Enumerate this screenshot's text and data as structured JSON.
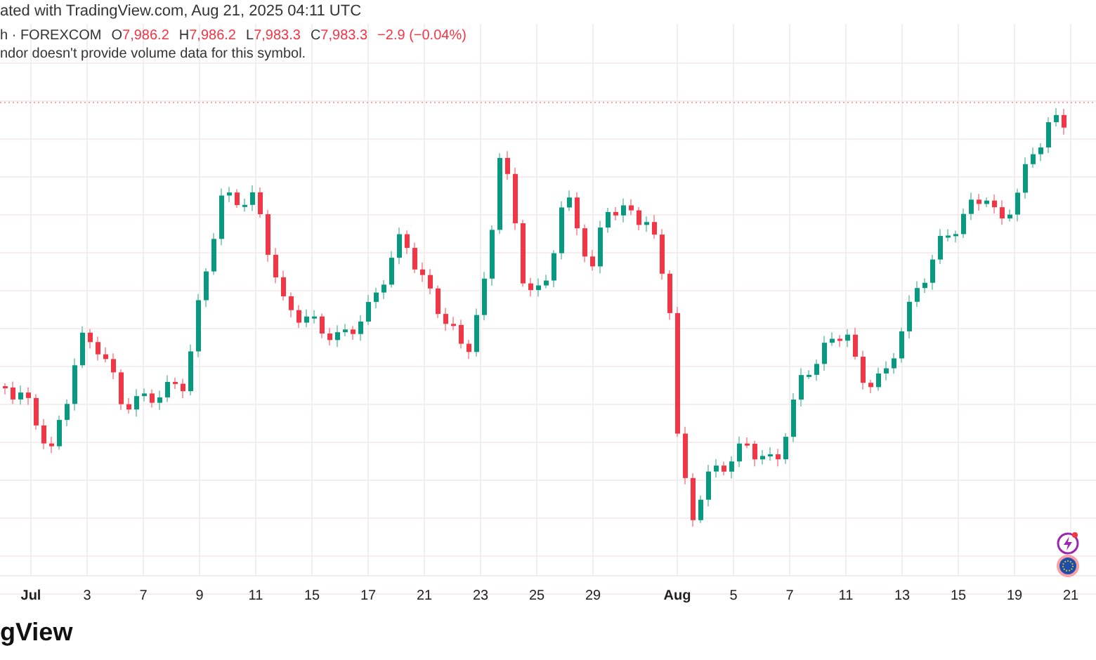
{
  "caption": "ated with TradingView.com, Aug 21, 2025 04:11 UTC",
  "legend": {
    "symbol": "h · FOREXCOM",
    "ohlc": [
      {
        "label": "O",
        "value": "7,986.2"
      },
      {
        "label": "H",
        "value": "7,986.2"
      },
      {
        "label": "L",
        "value": "7,983.3"
      },
      {
        "label": "C",
        "value": "7,983.3"
      }
    ],
    "change": "−2.9 (−0.04%)",
    "notice": "ndor doesn't provide volume data for this symbol."
  },
  "x_axis": [
    {
      "label": "Jul",
      "kind": "month"
    },
    {
      "label": "3",
      "kind": "day"
    },
    {
      "label": "7",
      "kind": "day"
    },
    {
      "label": "9",
      "kind": "day"
    },
    {
      "label": "11",
      "kind": "day"
    },
    {
      "label": "15",
      "kind": "day"
    },
    {
      "label": "17",
      "kind": "day"
    },
    {
      "label": "21",
      "kind": "day"
    },
    {
      "label": "23",
      "kind": "day"
    },
    {
      "label": "25",
      "kind": "day"
    },
    {
      "label": "29",
      "kind": "day"
    },
    {
      "label": "Aug",
      "kind": "month"
    },
    {
      "label": "5",
      "kind": "day"
    },
    {
      "label": "7",
      "kind": "day"
    },
    {
      "label": "11",
      "kind": "day"
    },
    {
      "label": "13",
      "kind": "day"
    },
    {
      "label": "15",
      "kind": "day"
    },
    {
      "label": "19",
      "kind": "day"
    },
    {
      "label": "21",
      "kind": "day"
    }
  ],
  "logo": "gView"
}
